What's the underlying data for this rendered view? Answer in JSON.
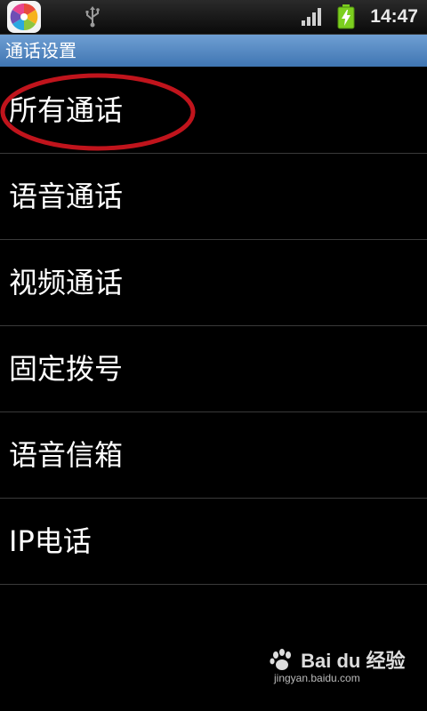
{
  "status_bar": {
    "time": "14:47",
    "app_icon": "color-pinwheel-app-icon",
    "usb_icon": "usb-icon",
    "signal_icon": "signal-bars-icon",
    "battery_icon": "battery-charging-icon",
    "battery_color": "#7ccf1f"
  },
  "title_bar": {
    "title": "通话设置",
    "color": "#4f86c4"
  },
  "settings_list": {
    "items": [
      {
        "label": "所有通话",
        "highlighted": true
      },
      {
        "label": "语音通话"
      },
      {
        "label": "视频通话"
      },
      {
        "label": "固定拨号"
      },
      {
        "label": "语音信箱"
      },
      {
        "label": "IP电话"
      }
    ],
    "highlight_color": "#c0141c"
  },
  "watermark": {
    "logo_text": "Bai du 经验",
    "url": "jingyan.baidu.com"
  }
}
